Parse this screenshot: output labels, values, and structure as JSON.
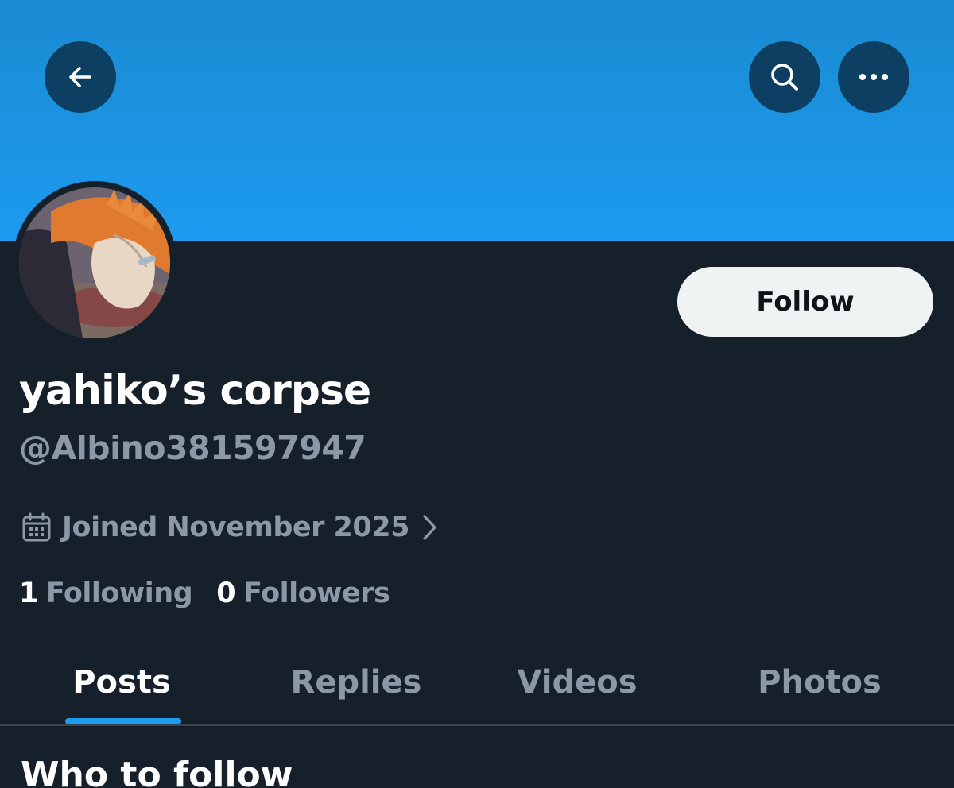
{
  "header": {
    "back_icon": "arrow-left-icon",
    "search_icon": "search-icon",
    "more_icon": "more-horizontal-icon",
    "banner_color": "#1d9bf0"
  },
  "profile": {
    "display_name": "yahiko’s corpse",
    "handle": "@Albino381597947",
    "joined": "Joined November 2025",
    "joined_icon": "calendar-icon",
    "follow_label": "Follow",
    "following_count": "1",
    "following_label": "Following",
    "followers_count": "0",
    "followers_label": "Followers"
  },
  "tabs": [
    {
      "label": "Posts",
      "active": true
    },
    {
      "label": "Replies",
      "active": false
    },
    {
      "label": "Videos",
      "active": false
    },
    {
      "label": "Photos",
      "active": false
    }
  ],
  "sections": {
    "who_to_follow": "Who to follow"
  },
  "colors": {
    "background": "#15202b",
    "accent": "#1d9bf0",
    "secondary_text": "#8b98a5"
  }
}
